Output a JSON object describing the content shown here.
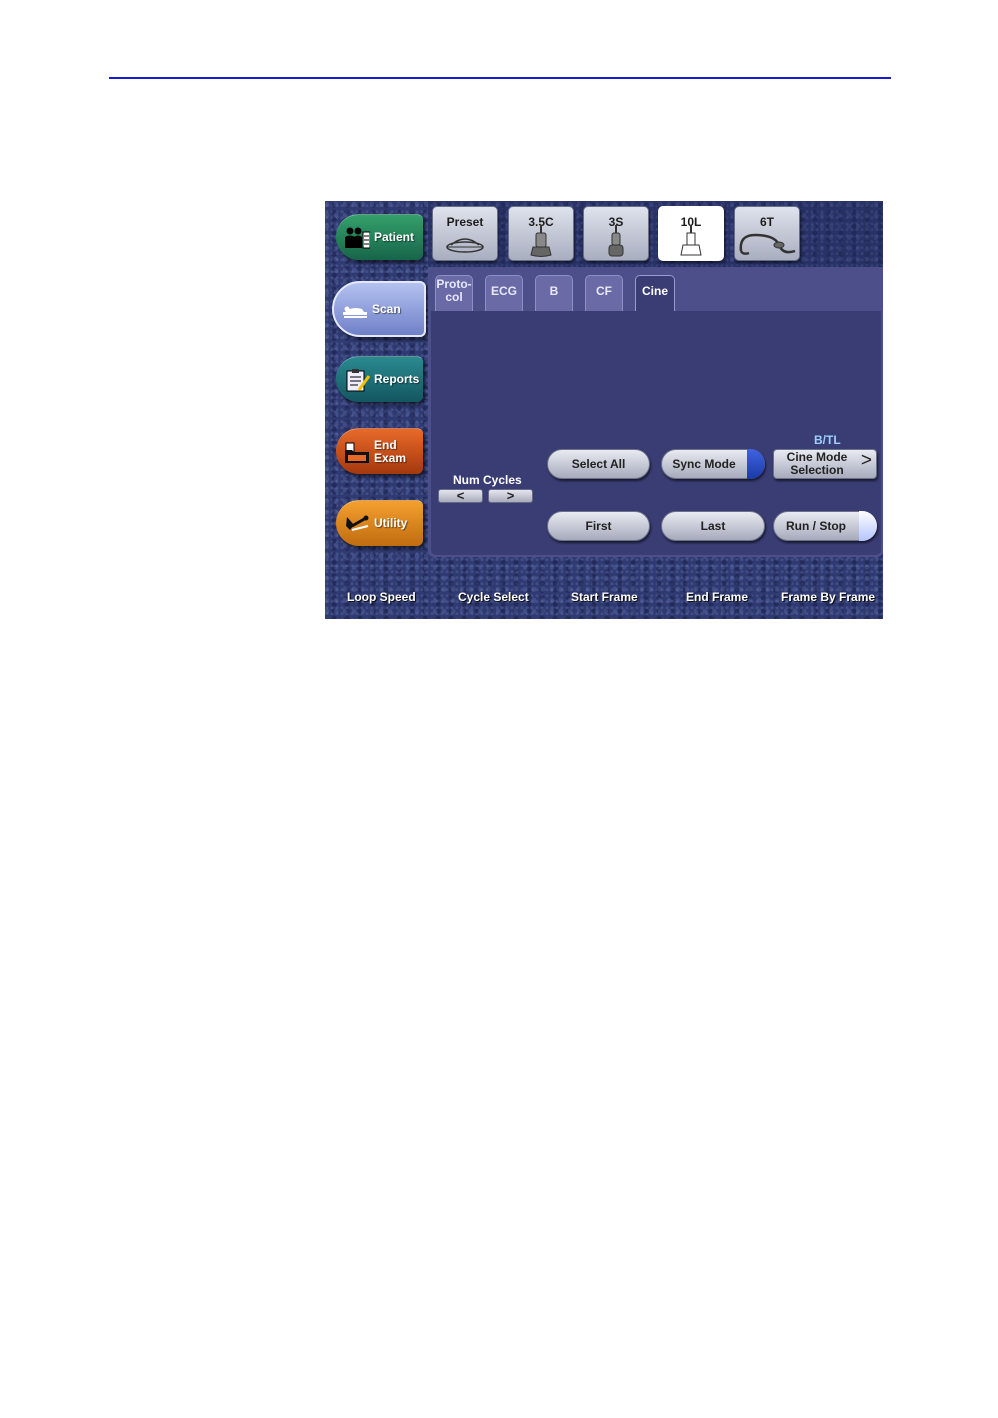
{
  "nav": {
    "patient": "Patient",
    "scan": "Scan",
    "reports": "Reports",
    "end_line1": "End",
    "end_line2": "Exam",
    "utility": "Utility"
  },
  "probes": [
    "Preset",
    "3.5C",
    "3S",
    "10L",
    "6T"
  ],
  "tabs": {
    "protocol_line1": "Proto-",
    "protocol_line2": "col",
    "ecg": "ECG",
    "b": "B",
    "cf": "CF",
    "cine": "Cine"
  },
  "controls": {
    "select_all": "Select All",
    "sync_mode": "Sync Mode",
    "btl": "B/TL",
    "cine_mode_line1": "Cine Mode",
    "cine_mode_line2": "Selection",
    "cine_mode_arrow": ">",
    "first": "First",
    "last": "Last",
    "run_stop": "Run / Stop",
    "num_cycles": "Num Cycles",
    "prev": "<",
    "next": ">"
  },
  "bottom": [
    "Loop Speed",
    "Cycle Select",
    "Start Frame",
    "End Frame",
    "Frame By Frame"
  ],
  "colors": {
    "accent_line": "#1a1ad0",
    "panel": "#4c4f8a",
    "content": "#3a3c74"
  }
}
